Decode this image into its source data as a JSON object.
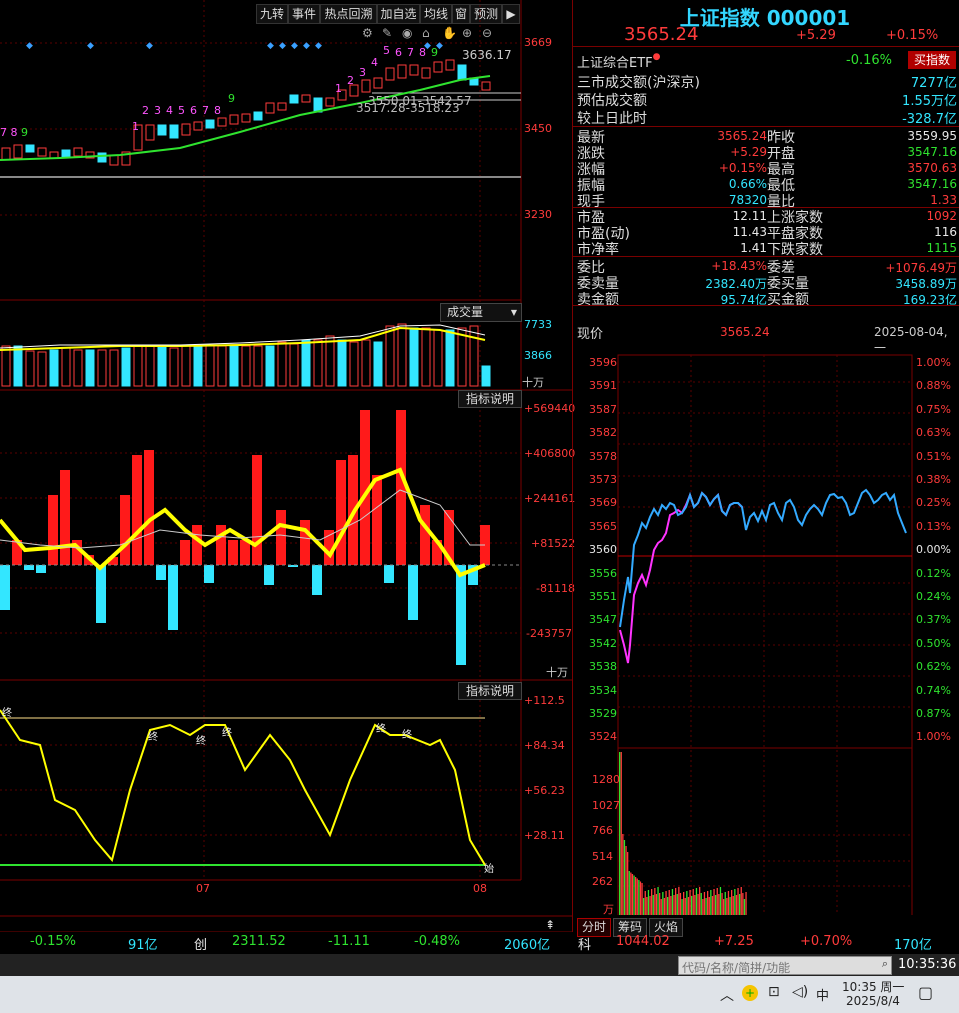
{
  "toolbar": {
    "buttons": [
      "九转",
      "事件",
      "热点回溯",
      "加自选",
      "均线",
      "窗",
      "预测"
    ]
  },
  "kline": {
    "price_high_label": "3636.17",
    "label_mid_1": "3550.01-3542.57",
    "label_mid_2": "3517.28-3518.23",
    "axis": [
      "3669",
      "3450",
      "3230"
    ],
    "seq_left": [
      "7",
      "8",
      "9"
    ],
    "seq_mid": [
      "1",
      "2",
      "3",
      "4",
      "5",
      "6",
      "7",
      "8",
      "9"
    ],
    "seq_right": [
      "1",
      "2",
      "3",
      "4",
      "5",
      "6",
      "7",
      "8",
      "9"
    ]
  },
  "volume": {
    "dropdown": "成交量",
    "axis": [
      "7733",
      "3866",
      "十万"
    ]
  },
  "indicator1": {
    "btn": "指标说明",
    "axis": [
      "+569440",
      "+406800",
      "+244161",
      "+81522",
      "-81118",
      "-243757",
      "十万"
    ]
  },
  "indicator2": {
    "btn": "指标说明",
    "axis": [
      "+112.5",
      "+84.34",
      "+56.23",
      "+28.11"
    ],
    "labels": [
      "终",
      "终",
      "终",
      "终",
      "终",
      "终",
      "始"
    ]
  },
  "date_axis": [
    "07",
    "08"
  ],
  "bottom_left": {
    "pct": "-0.15%",
    "amt": "91亿",
    "chuang_label": "创",
    "chuang_price": "2311.52",
    "chuang_chg": "-11.11",
    "chuang_pct": "-0.48%",
    "chuang_amt": "2060亿"
  },
  "quote": {
    "title": "上证指数 000001",
    "price": "3565.24",
    "change": "+5.29",
    "change_pct": "+0.15%",
    "etf_name": "上证综合ETF",
    "etf_pct": "-0.16%",
    "buy_btn": "买指数",
    "rows_top": [
      {
        "label": "三市成交额(沪深京)",
        "value": "7277亿",
        "color": "cyan"
      },
      {
        "label": "预估成交额",
        "value": "1.55万亿",
        "color": "cyan"
      },
      {
        "label": "较上日此时",
        "value": "-328.7亿",
        "color": "cyan"
      }
    ],
    "grid": [
      {
        "l1": "最新",
        "v1": "3565.24",
        "c1": "red",
        "l2": "昨收",
        "v2": "3559.95",
        "c2": "white"
      },
      {
        "l1": "涨跌",
        "v1": "+5.29",
        "c1": "red",
        "l2": "开盘",
        "v2": "3547.16",
        "c2": "green"
      },
      {
        "l1": "涨幅",
        "v1": "+0.15%",
        "c1": "red",
        "l2": "最高",
        "v2": "3570.63",
        "c2": "red"
      },
      {
        "l1": "振幅",
        "v1": "0.66%",
        "c1": "cyan",
        "l2": "最低",
        "v2": "3547.16",
        "c2": "green"
      },
      {
        "l1": "现手",
        "v1": "78320",
        "c1": "cyan",
        "l2": "量比",
        "v2": "1.33",
        "c2": "red"
      },
      {
        "l1": "市盈",
        "v1": "12.11",
        "c1": "white",
        "l2": "上涨家数",
        "v2": "1092",
        "c2": "red"
      },
      {
        "l1": "市盈(动)",
        "v1": "11.43",
        "c1": "white",
        "l2": "平盘家数",
        "v2": "116",
        "c2": "white"
      },
      {
        "l1": "市净率",
        "v1": "1.41",
        "c1": "white",
        "l2": "下跌家数",
        "v2": "1115",
        "c2": "green"
      },
      {
        "l1": "委比",
        "v1": "+18.43%",
        "c1": "red",
        "l2": "委差",
        "v2": "+1076.49万",
        "c2": "red"
      },
      {
        "l1": "委卖量",
        "v1": "2382.40万",
        "c1": "cyan",
        "l2": "委买量",
        "v2": "3458.89万",
        "c2": "cyan"
      },
      {
        "l1": "卖金额",
        "v1": "95.74亿",
        "c1": "cyan",
        "l2": "买金额",
        "v2": "169.23亿",
        "c2": "cyan"
      }
    ]
  },
  "intraday": {
    "label": "现价",
    "price": "3565.24",
    "date": "2025-08-04,一",
    "price_axis": [
      "3596",
      "3591",
      "3587",
      "3582",
      "3578",
      "3573",
      "3569",
      "3565",
      "3560",
      "3556",
      "3551",
      "3547",
      "3542",
      "3538",
      "3534",
      "3529",
      "3524"
    ],
    "pct_axis": [
      "1.00%",
      "0.88%",
      "0.75%",
      "0.63%",
      "0.51%",
      "0.38%",
      "0.25%",
      "0.13%",
      "0.00%",
      "0.12%",
      "0.24%",
      "0.37%",
      "0.50%",
      "0.62%",
      "0.74%",
      "0.87%",
      "1.00%"
    ],
    "vol_axis": [
      "1280",
      "1027",
      "766",
      "514",
      "262",
      "万"
    ],
    "tabs": [
      "分时",
      "筹码",
      "火焰"
    ]
  },
  "bottom_right": {
    "label": "科",
    "price": "1044.02",
    "chg": "+7.25",
    "pct": "+0.70%",
    "amt": "170亿"
  },
  "status": {
    "search_placeholder": "代码/名称/简拼/功能",
    "clock": "10:35:36"
  },
  "taskbar": {
    "ime": "中",
    "time": "10:35 周一",
    "date": "2025/8/4"
  },
  "colors": {
    "red": "#ff3b3b",
    "cyan": "#33e6ff",
    "green": "#2fe32f",
    "yellow": "#ffff00",
    "grid": "#7a0000"
  }
}
